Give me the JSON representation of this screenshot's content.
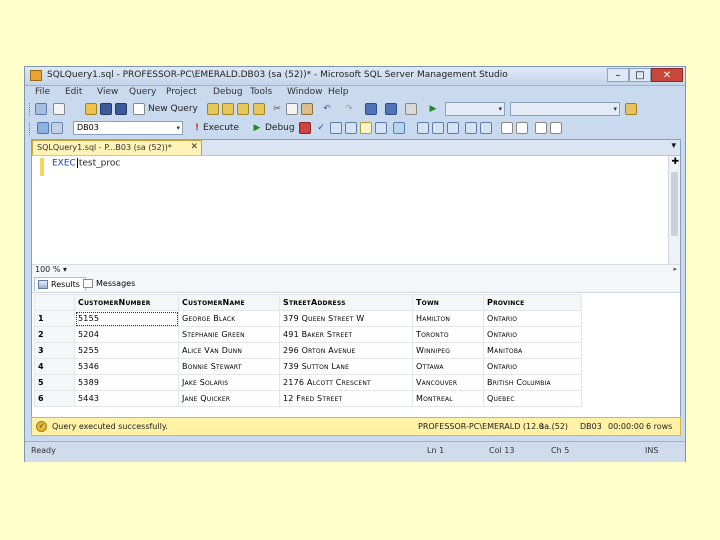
{
  "window": {
    "title": "SQLQuery1.sql - PROFESSOR-PC\\EMERALD.DB03 (sa (52))* - Microsoft SQL Server Management Studio",
    "min_label": "–",
    "max_label": "□",
    "close_label": "✕"
  },
  "menu": [
    "File",
    "Edit",
    "View",
    "Query",
    "Project",
    "Debug",
    "Tools",
    "Window",
    "Help"
  ],
  "toolbar1": {
    "new_query_label": "New Query"
  },
  "toolbar2": {
    "database": "DB03",
    "execute_label": "Execute",
    "debug_label": "Debug"
  },
  "document_tab": {
    "label": "SQLQuery1.sql - P...B03 (sa (52))*",
    "close": "✕"
  },
  "editor": {
    "keyword": "EXEC",
    "argument": "test_proc"
  },
  "zoom": "100 %",
  "results_tabs": {
    "results": "Results",
    "messages": "Messages"
  },
  "results": {
    "columns": [
      "CustomerNumber",
      "CustomerName",
      "StreetAddress",
      "Town",
      "Province"
    ],
    "rows": [
      {
        "n": "1",
        "cells": [
          "5155",
          "George Black",
          "379 Queen Street W",
          "Hamilton",
          "Ontario"
        ]
      },
      {
        "n": "2",
        "cells": [
          "5204",
          "Stephanie Green",
          "491 Baker Street",
          "Toronto",
          "Ontario"
        ]
      },
      {
        "n": "3",
        "cells": [
          "5255",
          "Alice Van Dunn",
          "296 Orton Avenue",
          "Winnipeg",
          "Manitoba"
        ]
      },
      {
        "n": "4",
        "cells": [
          "5346",
          "Bonnie Stewart",
          "739 Sutton Lane",
          "Ottawa",
          "Ontario"
        ]
      },
      {
        "n": "5",
        "cells": [
          "5389",
          "Jake Solaris",
          "2176 Alcott Crescent",
          "Vancouver",
          "British Columbia"
        ]
      },
      {
        "n": "6",
        "cells": [
          "5443",
          "Jane Quicker",
          "12 Fred Street",
          "Montreal",
          "Quebec"
        ]
      }
    ]
  },
  "query_status": {
    "message": "Query executed successfully.",
    "server": "PROFESSOR-PC\\EMERALD (12.0 ...",
    "user": "sa (52)",
    "database": "DB03",
    "elapsed": "00:00:00",
    "rows": "6 rows"
  },
  "app_status": {
    "ready": "Ready",
    "ln": "Ln 1",
    "col": "Col 13",
    "ch": "Ch 5",
    "mode": "INS"
  }
}
